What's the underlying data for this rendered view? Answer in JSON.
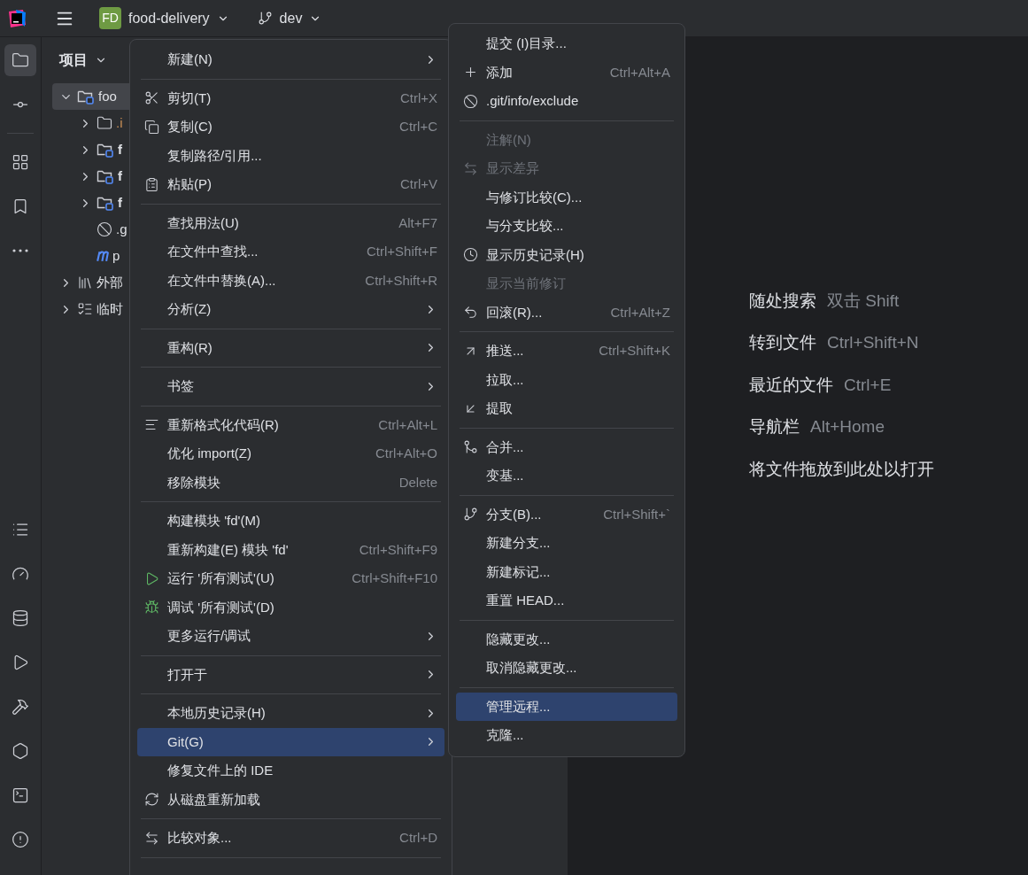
{
  "header": {
    "project_badge": "FD",
    "project": "food-delivery",
    "branch": "dev"
  },
  "toolbar": {
    "top": [
      {
        "selected": true
      },
      {
        "selected": false
      },
      {
        "selected": false
      },
      {
        "selected": false
      },
      {
        "selected": false
      }
    ],
    "bottom": [
      {
        "selected": false
      },
      {
        "selected": false
      },
      {
        "selected": false
      },
      {
        "selected": false
      },
      {
        "selected": false
      },
      {
        "selected": false
      },
      {
        "selected": false
      },
      {
        "selected": false
      }
    ]
  },
  "project": {
    "title": "项目",
    "tree": [
      {
        "label": "foo",
        "kind": "module",
        "expanded": true,
        "selected": true,
        "children": [
          {
            "label": ".i",
            "kind": "folder",
            "expanded": false,
            "selected": false
          },
          {
            "label": "f",
            "kind": "module",
            "expanded": false,
            "selected": false
          },
          {
            "label": "f",
            "kind": "module",
            "expanded": false,
            "selected": false
          },
          {
            "label": "f",
            "kind": "module",
            "expanded": false,
            "selected": false
          },
          {
            "label": ".g",
            "kind": "ignore",
            "selected": false
          },
          {
            "label": "p",
            "kind": "maven",
            "selected": false
          }
        ]
      },
      {
        "label": "外部",
        "kind": "libraries",
        "expanded": false,
        "selected": false
      },
      {
        "label": "临时",
        "kind": "scratches",
        "expanded": false,
        "selected": false
      }
    ]
  },
  "hints": [
    {
      "label": "随处搜索",
      "shortcut": "双击 Shift"
    },
    {
      "label": "转到文件",
      "shortcut": "Ctrl+Shift+N"
    },
    {
      "label": "最近的文件",
      "shortcut": "Ctrl+E"
    },
    {
      "label": "导航栏",
      "shortcut": "Alt+Home"
    },
    {
      "label": "将文件拖放到此处以打开"
    }
  ],
  "context_menu": {
    "items": [
      {
        "kind": "item",
        "label": "新建(N)",
        "submenu": true,
        "selected": false
      },
      {
        "kind": "separator"
      },
      {
        "kind": "item",
        "label": "剪切(T)",
        "shortcut": "Ctrl+X",
        "selected": false
      },
      {
        "kind": "item",
        "label": "复制(C)",
        "shortcut": "Ctrl+C",
        "selected": false
      },
      {
        "kind": "item",
        "label": "复制路径/引用...",
        "selected": false
      },
      {
        "kind": "item",
        "label": "粘贴(P)",
        "shortcut": "Ctrl+V",
        "selected": false
      },
      {
        "kind": "separator"
      },
      {
        "kind": "item",
        "label": "查找用法(U)",
        "shortcut": "Alt+F7",
        "selected": false
      },
      {
        "kind": "item",
        "label": "在文件中查找...",
        "shortcut": "Ctrl+Shift+F",
        "selected": false
      },
      {
        "kind": "item",
        "label": "在文件中替换(A)...",
        "shortcut": "Ctrl+Shift+R",
        "selected": false
      },
      {
        "kind": "item",
        "label": "分析(Z)",
        "submenu": true,
        "selected": false
      },
      {
        "kind": "separator"
      },
      {
        "kind": "item",
        "label": "重构(R)",
        "submenu": true,
        "selected": false
      },
      {
        "kind": "separator"
      },
      {
        "kind": "item",
        "label": "书签",
        "submenu": true,
        "selected": false
      },
      {
        "kind": "separator"
      },
      {
        "kind": "item",
        "label": "重新格式化代码(R)",
        "shortcut": "Ctrl+Alt+L",
        "selected": false
      },
      {
        "kind": "item",
        "label": "优化 import(Z)",
        "shortcut": "Ctrl+Alt+O",
        "selected": false
      },
      {
        "kind": "item",
        "label": "移除模块",
        "shortcut": "Delete",
        "selected": false
      },
      {
        "kind": "separator"
      },
      {
        "kind": "item",
        "label": "构建模块 'fd'(M)",
        "selected": false
      },
      {
        "kind": "item",
        "label": "重新构建(E) 模块 'fd'",
        "shortcut": "Ctrl+Shift+F9",
        "selected": false
      },
      {
        "kind": "item",
        "label": "运行 '所有测试'(U)",
        "shortcut": "Ctrl+Shift+F10",
        "selected": false
      },
      {
        "kind": "item",
        "label": "调试 '所有测试'(D)",
        "selected": false
      },
      {
        "kind": "item",
        "label": "更多运行/调试",
        "submenu": true,
        "selected": false
      },
      {
        "kind": "separator"
      },
      {
        "kind": "item",
        "label": "打开于",
        "submenu": true,
        "selected": false
      },
      {
        "kind": "separator"
      },
      {
        "kind": "item",
        "label": "本地历史记录(H)",
        "submenu": true,
        "selected": false
      },
      {
        "kind": "item",
        "label": "Git(G)",
        "submenu": true,
        "selected": true
      },
      {
        "kind": "item",
        "label": "修复文件上的 IDE",
        "selected": false
      },
      {
        "kind": "item",
        "label": "从磁盘重新加载",
        "selected": false
      },
      {
        "kind": "separator"
      },
      {
        "kind": "item",
        "label": "比较对象...",
        "shortcut": "Ctrl+D",
        "selected": false
      },
      {
        "kind": "separator"
      }
    ]
  },
  "git_menu": {
    "items": [
      {
        "kind": "item",
        "label": "提交 (I)目录...",
        "disabled": false,
        "selected": false
      },
      {
        "kind": "item",
        "label": "添加",
        "shortcut": "Ctrl+Alt+A",
        "disabled": false,
        "selected": false
      },
      {
        "kind": "item",
        "label": ".git/info/exclude",
        "disabled": false,
        "selected": false
      },
      {
        "kind": "separator"
      },
      {
        "kind": "item",
        "label": "注解(N)",
        "disabled": true,
        "selected": false
      },
      {
        "kind": "item",
        "label": "显示差异",
        "disabled": true,
        "selected": false
      },
      {
        "kind": "item",
        "label": "与修订比较(C)...",
        "disabled": false,
        "selected": false
      },
      {
        "kind": "item",
        "label": "与分支比较...",
        "disabled": false,
        "selected": false
      },
      {
        "kind": "item",
        "label": "显示历史记录(H)",
        "disabled": false,
        "selected": false
      },
      {
        "kind": "item",
        "label": "显示当前修订",
        "disabled": true,
        "selected": false
      },
      {
        "kind": "item",
        "label": "回滚(R)...",
        "shortcut": "Ctrl+Alt+Z",
        "disabled": false,
        "selected": false
      },
      {
        "kind": "separator"
      },
      {
        "kind": "item",
        "label": "推送...",
        "shortcut": "Ctrl+Shift+K",
        "disabled": false,
        "selected": false
      },
      {
        "kind": "item",
        "label": "拉取...",
        "disabled": false,
        "selected": false
      },
      {
        "kind": "item",
        "label": "提取",
        "disabled": false,
        "selected": false
      },
      {
        "kind": "separator"
      },
      {
        "kind": "item",
        "label": "合并...",
        "disabled": false,
        "selected": false
      },
      {
        "kind": "item",
        "label": "变基...",
        "disabled": false,
        "selected": false
      },
      {
        "kind": "separator"
      },
      {
        "kind": "item",
        "label": "分支(B)...",
        "shortcut": "Ctrl+Shift+`",
        "disabled": false,
        "selected": false
      },
      {
        "kind": "item",
        "label": "新建分支...",
        "disabled": false,
        "selected": false
      },
      {
        "kind": "item",
        "label": "新建标记...",
        "disabled": false,
        "selected": false
      },
      {
        "kind": "item",
        "label": "重置 HEAD...",
        "disabled": false,
        "selected": false
      },
      {
        "kind": "separator"
      },
      {
        "kind": "item",
        "label": "隐藏更改...",
        "disabled": false,
        "selected": false
      },
      {
        "kind": "item",
        "label": "取消隐藏更改...",
        "disabled": false,
        "selected": false
      },
      {
        "kind": "separator"
      },
      {
        "kind": "item",
        "label": "管理远程...",
        "disabled": false,
        "selected": true
      },
      {
        "kind": "item",
        "label": "克隆...",
        "disabled": false,
        "selected": false
      }
    ]
  }
}
